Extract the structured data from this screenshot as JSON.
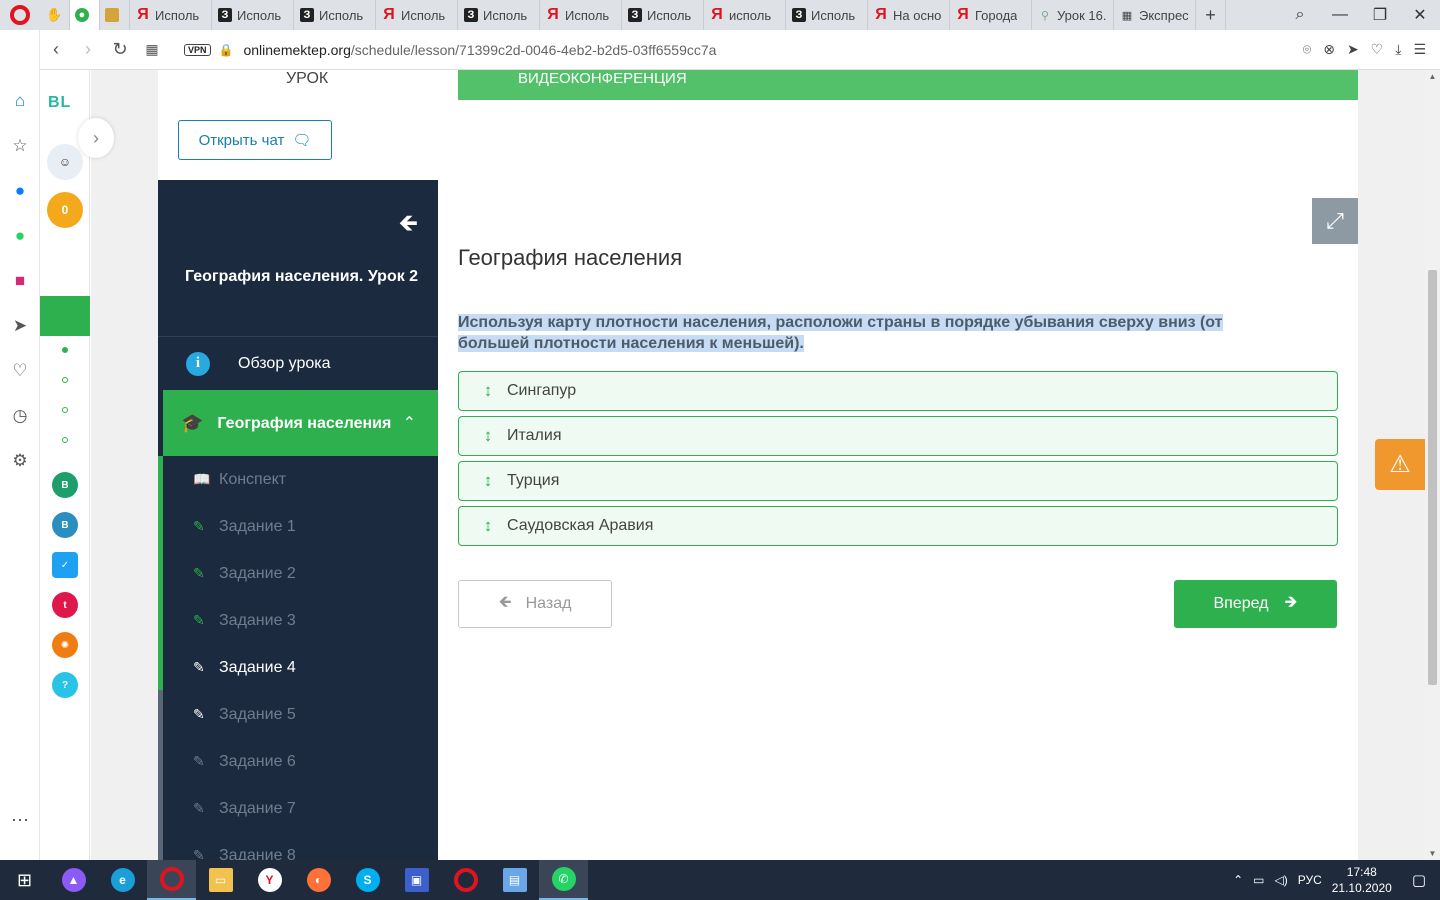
{
  "browser": {
    "tabs": [
      {
        "title": "",
        "icon": "g",
        "active": true
      },
      {
        "title": "",
        "icon": "pic",
        "active": false
      },
      {
        "title": "Исполь",
        "icon": "ya"
      },
      {
        "title": "Исполь",
        "icon": "z"
      },
      {
        "title": "Исполь",
        "icon": "z"
      },
      {
        "title": "Исполь",
        "icon": "ya"
      },
      {
        "title": "Исполь",
        "icon": "z"
      },
      {
        "title": "Исполь",
        "icon": "ya"
      },
      {
        "title": "Исполь",
        "icon": "z"
      },
      {
        "title": "исполь",
        "icon": "ya"
      },
      {
        "title": "Исполь",
        "icon": "z"
      },
      {
        "title": "На осно",
        "icon": "ya"
      },
      {
        "title": "Города",
        "icon": "ya"
      },
      {
        "title": "Урок 16.",
        "icon": "pin"
      },
      {
        "title": "Экспрес",
        "icon": "grid"
      }
    ],
    "vpn_label": "VPN",
    "url_host": "onlinemektep.org",
    "url_path": "/schedule/lesson/71399c2d-0046-4eb2-b2d5-03ff6559cc7a"
  },
  "panel": {
    "logo": "BL",
    "coins": "0"
  },
  "header": {
    "urok_label": "УРОК",
    "banner_label": "ВИДЕОКОНФЕРЕНЦИЯ",
    "chat_button": "Открыть чат"
  },
  "menu": {
    "lesson_title": "География населения. Урок 2",
    "overview": "Обзор урока",
    "section": "География населения",
    "items": [
      {
        "label": "Конспект",
        "state": "done"
      },
      {
        "label": "Задание 1",
        "state": "done"
      },
      {
        "label": "Задание 2",
        "state": "done"
      },
      {
        "label": "Задание 3",
        "state": "done"
      },
      {
        "label": "Задание 4",
        "state": "current"
      },
      {
        "label": "Задание 5",
        "state": "todo"
      },
      {
        "label": "Задание 6",
        "state": "todo"
      },
      {
        "label": "Задание 7",
        "state": "todo"
      },
      {
        "label": "Задание 8",
        "state": "todo"
      }
    ]
  },
  "task": {
    "title": "География населения",
    "question": "Используя карту плотности населения, расположи страны в порядке убывания сверху вниз (от большей плотности населения к меньшей).",
    "answers": [
      "Сингапур",
      "Италия",
      "Турция",
      "Саудовская Аравия"
    ],
    "back_label": "Назад",
    "forward_label": "Вперед"
  },
  "taskbar": {
    "lang": "РУС",
    "time": "17:48",
    "date": "21.10.2020"
  },
  "colors": {
    "accent": "#2eb04e",
    "menu_bg": "#1b2a3e",
    "warn": "#f0982d"
  }
}
